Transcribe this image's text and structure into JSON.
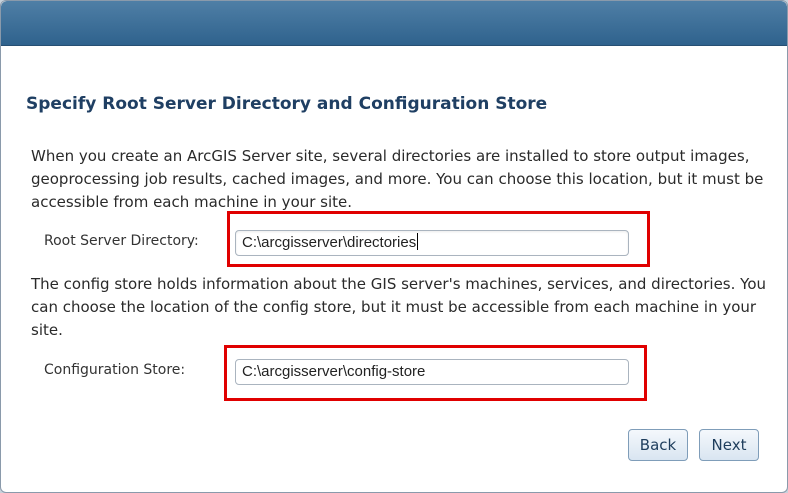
{
  "heading": "Specify Root Server Directory and Configuration Store",
  "intro_text": "When you create an ArcGIS Server site, several directories are installed to store output images, geoprocessing job results, cached images, and more. You can choose this location, but it must be accessible from each machine in your site.",
  "root_dir": {
    "label": "Root Server Directory:",
    "value": "C:\\arcgisserver\\directories"
  },
  "config_text": "The config store holds information about the GIS server's machines, services, and directories. You can choose the location of the config store, but it must be accessible from each machine in your site.",
  "config_store": {
    "label": "Configuration Store:",
    "value": "C:\\arcgisserver\\config-store"
  },
  "buttons": {
    "back": "Back",
    "next": "Next"
  },
  "colors": {
    "title_bar": "#3a6c96",
    "heading": "#1f3f63",
    "highlight": "#e00000"
  }
}
